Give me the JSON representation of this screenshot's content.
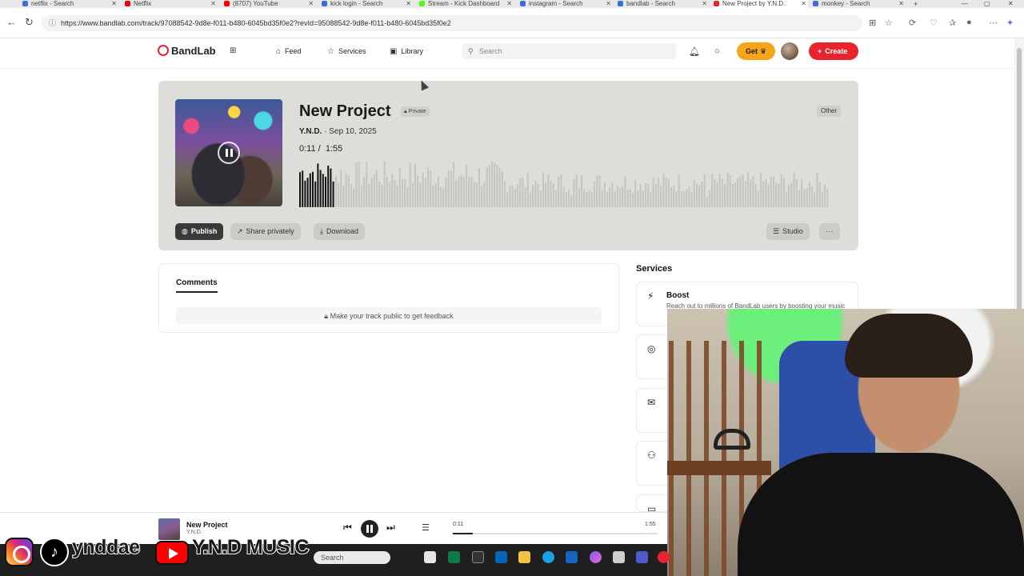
{
  "browser": {
    "tabs": [
      {
        "label": "netflix - Search",
        "color": "#3b6fd8",
        "active": false
      },
      {
        "label": "Netflix",
        "color": "#e50914",
        "active": false
      },
      {
        "label": "(8707) YouTube",
        "color": "#ff0000",
        "active": false
      },
      {
        "label": "kick login - Search",
        "color": "#3b6fd8",
        "active": false
      },
      {
        "label": "Stream - Kick Dashboard",
        "color": "#53fc18",
        "active": false
      },
      {
        "label": "instagram - Search",
        "color": "#3b6fd8",
        "active": false
      },
      {
        "label": "bandlab - Search",
        "color": "#3b6fd8",
        "active": false
      },
      {
        "label": "New Project by Y.N.D.",
        "color": "#e8252f",
        "active": true
      },
      {
        "label": "monkey - Search",
        "color": "#3b6fd8",
        "active": false
      }
    ],
    "url": "https://www.bandlab.com/track/97088542-9d8e-f011-b480-6045bd35f0e2?revId=95088542-9d8e-f011-b480-6045bd35f0e2"
  },
  "header": {
    "logo": "BandLab",
    "nav": [
      {
        "label": "Feed",
        "icon": "home-icon"
      },
      {
        "label": "Services",
        "icon": "star-icon"
      },
      {
        "label": "Library",
        "icon": "library-icon"
      }
    ],
    "search_placeholder": "Search",
    "get_label": "Get",
    "create_label": "Create"
  },
  "track": {
    "title": "New Project",
    "privacy": "Private",
    "genre": "Other",
    "artist": "Y.N.D.",
    "date": "Sep 10, 2025",
    "current_time": "0:11",
    "duration": "1:55",
    "progress": 0.096,
    "buttons": {
      "publish": "Publish",
      "share": "Share privately",
      "download": "Download",
      "studio": "Studio",
      "more": "···"
    }
  },
  "comments": {
    "tab": "Comments",
    "message": "Make your track public to get feedback"
  },
  "services": {
    "heading": "Services",
    "items": [
      {
        "title": "Boost",
        "desc": "Reach out to millions of BandLab users by boosting your music",
        "icon": "bolt-icon"
      },
      {
        "title": "",
        "desc": "",
        "icon": "distribution-icon"
      },
      {
        "title": "",
        "desc": "",
        "icon": "mail-icon"
      },
      {
        "title": "",
        "desc": "",
        "icon": "collab-icon"
      },
      {
        "title": "",
        "desc": "",
        "icon": "chat-icon"
      }
    ]
  },
  "player": {
    "title": "New Project",
    "artist": "Y.N.D.",
    "current_time": "0:11",
    "duration": "1:55",
    "progress": 0.096
  },
  "taskbar": {
    "search_placeholder": "Search"
  },
  "social": {
    "tiktok_handle": "ynddae",
    "youtube_channel": "Y.N.D MUSIC"
  }
}
